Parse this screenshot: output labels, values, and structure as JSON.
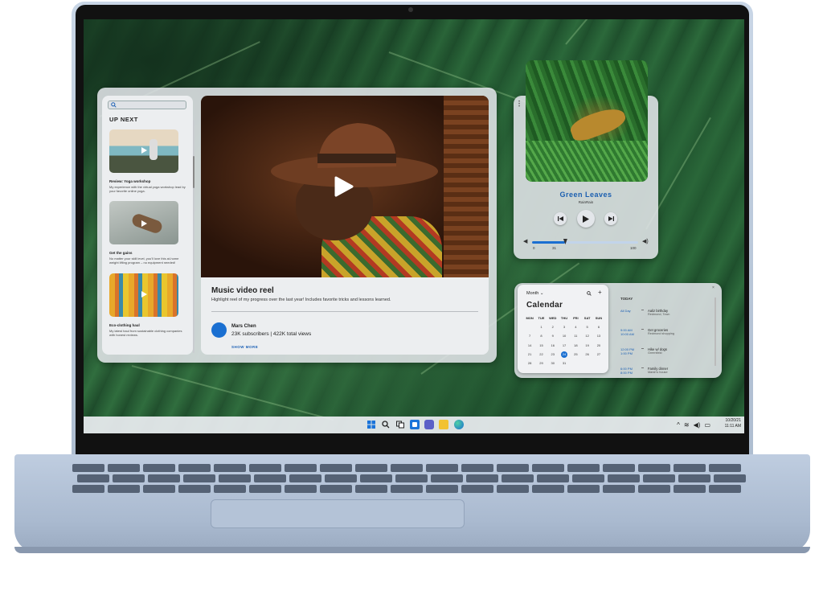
{
  "video_widget": {
    "search_icon": "search-icon",
    "up_next_label": "UP NEXT",
    "playlist": [
      {
        "title": "Review: Yoga workshop",
        "desc": "My experience with the virtual yoga workshop lead by your favorite online yoga."
      },
      {
        "title": "Get the gains",
        "desc": "No matter your skill level, you'll love this at-home weight lifting program – no equipment needed!"
      },
      {
        "title": "Eco-clothing haul",
        "desc": "My latest haul from sustainable clothing companies with honest reviews."
      }
    ],
    "main": {
      "title": "Music video reel",
      "subtitle": "Highlight reel of my progress over the last year! Includes favorite tricks and lessons learned.",
      "channel_name": "Mars Chen",
      "channel_stats": "23K subscribers | 422K total views",
      "show_more": "SHOW MORE"
    }
  },
  "music_widget": {
    "song_title": "Green Leaves",
    "artist": "RainRain",
    "volume": {
      "min_label": "0",
      "current_label": "31",
      "max_label": "100",
      "level": 0.31
    },
    "accent": "#1b5fb0"
  },
  "calendar_widget": {
    "view_mode": "Month",
    "title": "Calendar",
    "weekdays": [
      "MON",
      "TUE",
      "WED",
      "THU",
      "FRI",
      "SAT",
      "SUN"
    ],
    "days": [
      "",
      "1",
      "2",
      "3",
      "4",
      "5",
      "6",
      "7",
      "8",
      "9",
      "10",
      "11",
      "12",
      "13",
      "14",
      "15",
      "16",
      "17",
      "18",
      "19",
      "20",
      "21",
      "22",
      "23",
      "24",
      "25",
      "26",
      "27",
      "28",
      "29",
      "30",
      "31",
      "",
      "",
      ""
    ],
    "selected_day": "24",
    "agenda_header": "TODAY",
    "events": [
      {
        "time": "All Day",
        "title": "Aaliz birthday",
        "location": "Redmond, Town"
      },
      {
        "time": "9:00 AM\n10:00 AM",
        "title": "Get groceries",
        "location": "Redmond shopping"
      },
      {
        "time": "12:00 PM\n1:00 PM",
        "title": "Hike w/ dogs",
        "location": "Greenfield"
      },
      {
        "time": "6:00 PM\n8:00 PM",
        "title": "Family dinner",
        "location": "Marsh's house"
      }
    ]
  },
  "taskbar": {
    "icons": [
      "windows-start-icon",
      "search-icon",
      "task-view-icon",
      "widgets-icon",
      "teams-chat-icon",
      "file-explorer-icon",
      "edge-browser-icon"
    ],
    "date": "10/20/21",
    "time": "11:11 AM"
  }
}
